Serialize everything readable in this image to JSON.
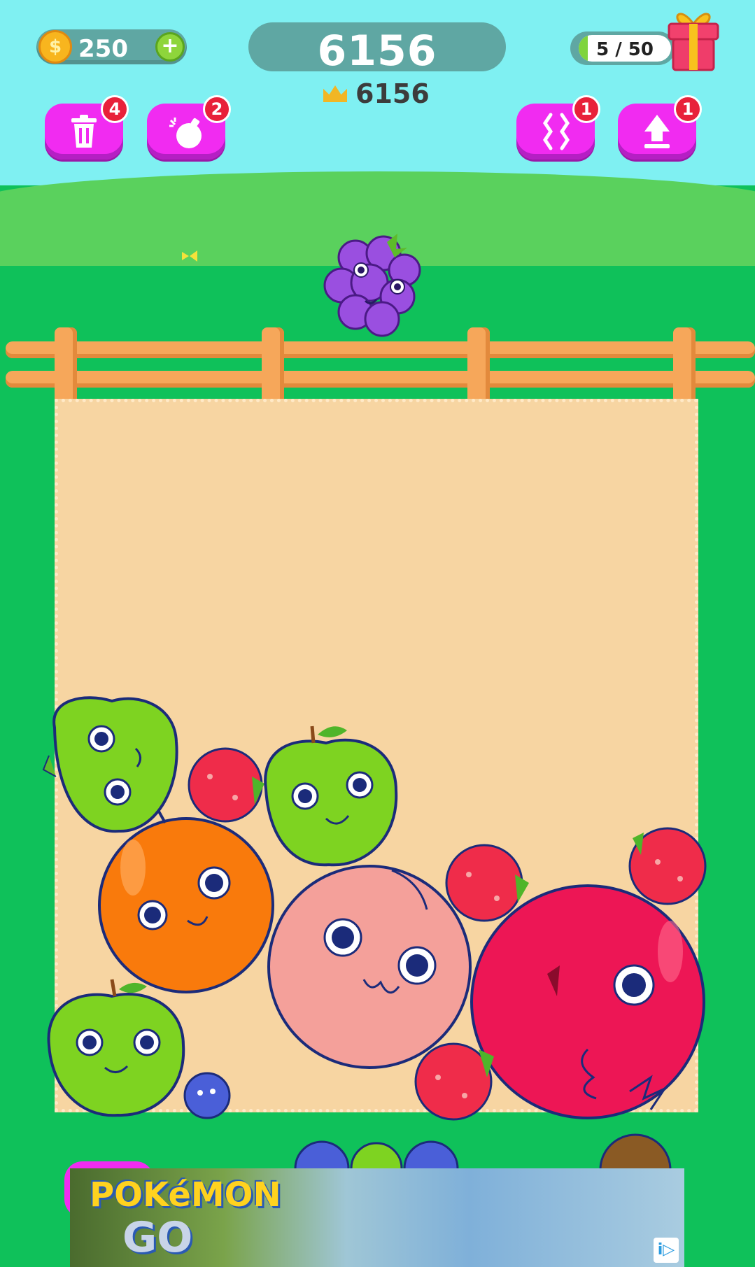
{
  "hud": {
    "coins": "250",
    "coin_symbol": "$",
    "plus_symbol": "+",
    "score": "6156",
    "best_score": "6156",
    "progress_text": "5 / 50",
    "progress_fraction": 0.1
  },
  "powerups": [
    {
      "name": "trash",
      "count": "4"
    },
    {
      "name": "bomb",
      "count": "2"
    },
    {
      "name": "shake",
      "count": "1"
    },
    {
      "name": "upgrade",
      "count": "1"
    }
  ],
  "next_fruit": "grape",
  "fruits": [
    {
      "kind": "green-apple"
    },
    {
      "kind": "strawberry"
    },
    {
      "kind": "green-apple"
    },
    {
      "kind": "orange"
    },
    {
      "kind": "peach"
    },
    {
      "kind": "strawberry"
    },
    {
      "kind": "strawberry"
    },
    {
      "kind": "pomegranate"
    },
    {
      "kind": "green-apple"
    },
    {
      "kind": "blueberry"
    },
    {
      "kind": "strawberry"
    }
  ],
  "ad": {
    "brand_line1": "POKéMON",
    "brand_line2": "GO",
    "badge": "i▷"
  },
  "colors": {
    "sky": "#7ff0f2",
    "grass": "#0fc15a",
    "powerup_button": "#f12bf1",
    "badge": "#e8213a",
    "box": "#f7d5a2"
  }
}
